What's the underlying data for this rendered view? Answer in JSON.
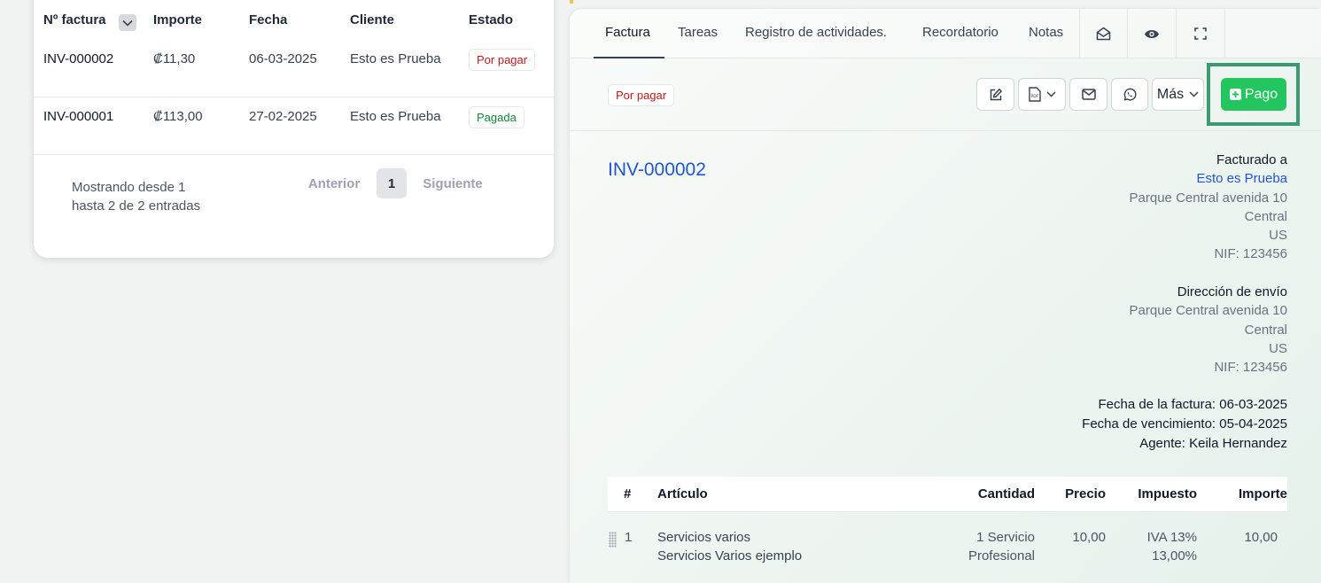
{
  "list": {
    "headers": {
      "number": "Nº factura",
      "amount": "Importe",
      "date": "Fecha",
      "client": "Cliente",
      "status": "Estado"
    },
    "rows": [
      {
        "number": "INV-000002",
        "amount": "₡11,30",
        "date": "06-03-2025",
        "client": "Esto es Prueba",
        "status": "Por pagar"
      },
      {
        "number": "INV-000001",
        "amount": "₡113,00",
        "date": "27-02-2025",
        "client": "Esto es Prueba",
        "status": "Pagada"
      }
    ],
    "showing": "Mostrando desde 1 hasta 2 de 2 entradas",
    "pagination": {
      "prev": "Anterior",
      "current": "1",
      "next": "Siguiente"
    }
  },
  "detail": {
    "tabs": [
      "Factura",
      "Tareas",
      "Registro de actividades.",
      "Recordatorio",
      "Notas"
    ],
    "tab_icons": [
      "envelope-open-icon",
      "eye-icon",
      "expand-icon"
    ],
    "status": "Por pagar",
    "toolbar": {
      "more_label": "Más",
      "pay_label": "Pago"
    },
    "invoice_number": "INV-000002",
    "billed_to": {
      "title": "Facturado a",
      "client": "Esto es Prueba",
      "lines": [
        "Parque Central avenida 10",
        "Central",
        "US",
        "NIF: 123456"
      ]
    },
    "shipping": {
      "title": "Dirección de envío",
      "lines": [
        "Parque Central avenida 10",
        "Central",
        "US",
        "NIF: 123456"
      ]
    },
    "dates": {
      "invoice_date_label": "Fecha de la factura:",
      "invoice_date": "06-03-2025",
      "due_date_label": "Fecha de vencimiento:",
      "due_date": "05-04-2025",
      "agent_label": "Agente:",
      "agent": "Keila Hernandez"
    },
    "items_headers": {
      "num": "#",
      "item": "Artículo",
      "qty": "Cantidad",
      "price": "Precio",
      "tax": "Impuesto",
      "amount": "Importe"
    },
    "items": [
      {
        "num": "1",
        "name": "Servicios varios",
        "description": "Servicios Varios ejemplo",
        "qty": "1 Servicio",
        "qty_unit": "Profesional",
        "price": "10,00",
        "tax": "IVA 13%",
        "tax_rate": "13,00%",
        "amount": "10,00"
      }
    ]
  },
  "colors": {
    "accent_blue": "#2156c9",
    "pay_green": "#22c55e",
    "unpaid_red": "#b91c1c",
    "paid_green": "#15803d",
    "highlight": "#3a9a72"
  }
}
